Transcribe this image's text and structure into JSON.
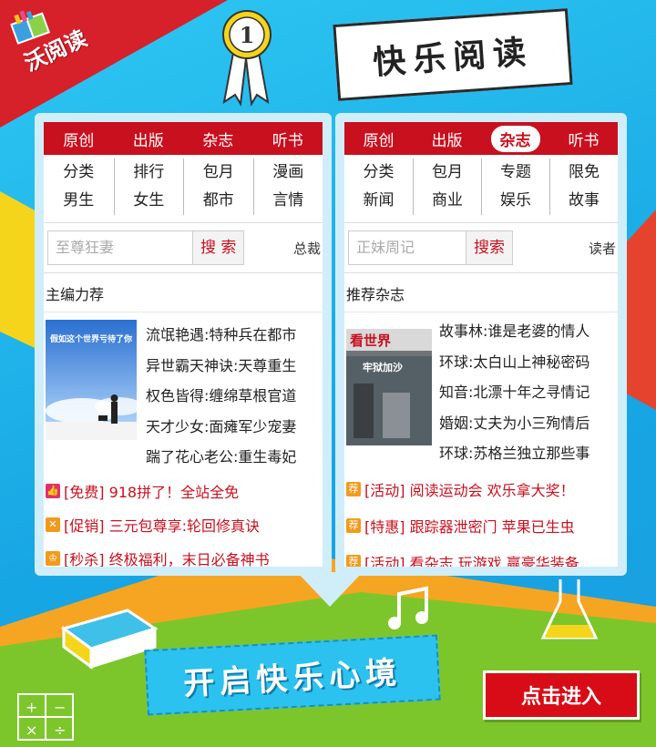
{
  "brand": {
    "logo_text": "沃阅读",
    "badge_number": "1"
  },
  "header_banner": {
    "text": "快乐阅读"
  },
  "left_phone": {
    "tabs": [
      "原创",
      "出版",
      "杂志",
      "听书"
    ],
    "categories": [
      "分类",
      "排行",
      "包月",
      "漫画",
      "男生",
      "女生",
      "都市",
      "言情"
    ],
    "search": {
      "placeholder": "至尊狂妻",
      "button": "搜 索",
      "extra": "总裁"
    },
    "section_title": "主编力荐",
    "cover_title": "假如这个世界亏待了你",
    "titles": [
      "流氓艳遇:特种兵在都市",
      "异世霸天神诀:天尊重生",
      "权色皆得:缠绵草根官道",
      "天才少女:面瘫军少宠妻",
      "踹了花心老公:重生毒妃"
    ],
    "promos": [
      {
        "icon": "thumb-icon",
        "color": "#e0316a",
        "text": "[免费] 918拼了！全站全免"
      },
      {
        "icon": "star-icon",
        "color": "#f29a1c",
        "text": "[促销] 三元包尊享:轮回修真诀"
      },
      {
        "icon": "trophy-icon",
        "color": "#f29a1c",
        "text": "[秒杀] 终极福利，末日必备神书"
      }
    ]
  },
  "right_phone": {
    "tabs": [
      "原创",
      "出版",
      "杂志",
      "听书"
    ],
    "active_tab": "杂志",
    "categories": [
      "分类",
      "包月",
      "专题",
      "限免",
      "新闻",
      "商业",
      "娱乐",
      "故事"
    ],
    "search": {
      "placeholder": "正妹周记",
      "button": "搜索",
      "extra": "读者"
    },
    "section_title": "推荐杂志",
    "cover_title": "看世界",
    "cover_subtitle": "牢狱加沙",
    "titles": [
      "故事林:谁是老婆的情人",
      "环球:太白山上神秘密码",
      "知音:北漂十年之寻情记",
      "婚姻:丈夫为小三殉情后",
      "环球:苏格兰独立那些事"
    ],
    "promo_icon_label": "荐",
    "promos": [
      "[活动] 阅读运动会 欢乐拿大奖！",
      "[特惠] 跟踪器泄密门 苹果已生虫",
      "[活动] 看杂志 玩游戏 赢豪华装备"
    ]
  },
  "footer": {
    "slogan": "开启快乐心境",
    "enter_button": "点击进入"
  },
  "colors": {
    "brand_red": "#c8101f",
    "sky_blue": "#1fb6e8",
    "orange": "#f6a522",
    "green": "#7cc62b"
  }
}
